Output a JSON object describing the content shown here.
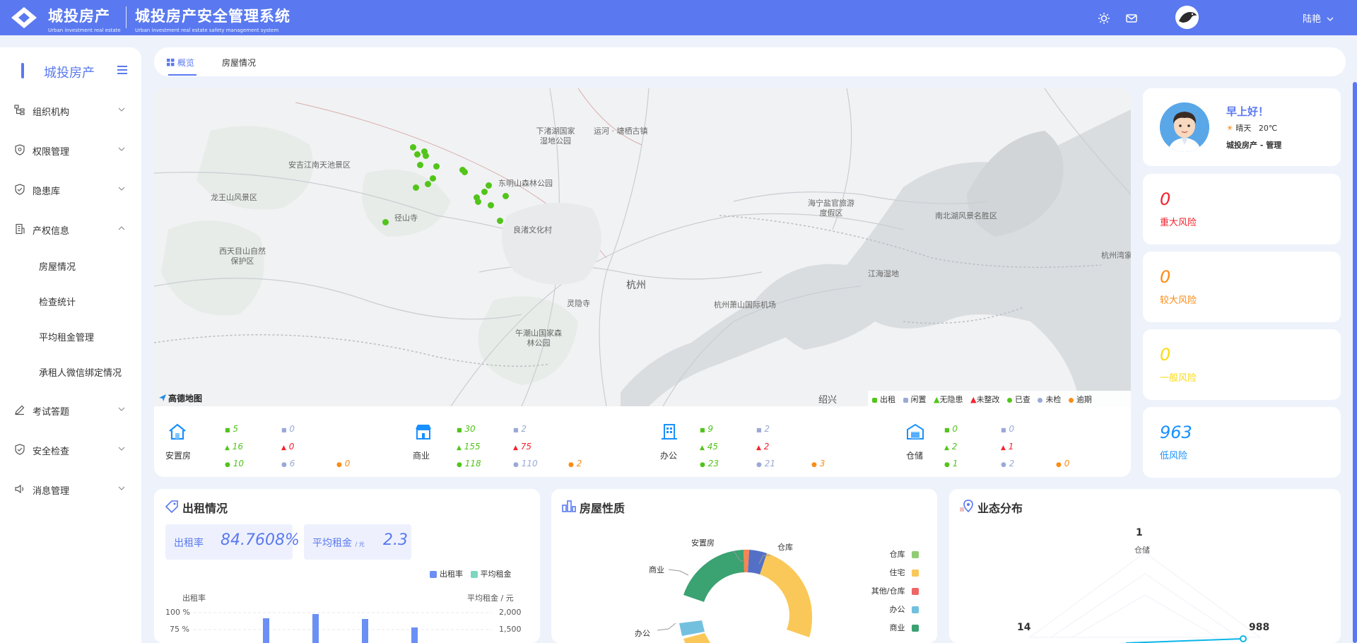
{
  "header": {
    "brand_cn": "城投房产",
    "brand_en": "Urban investment real estate",
    "system_cn": "城投房产安全管理系统",
    "system_en": "Urban investment real estate safety management system",
    "user": "陆艳",
    "icons": [
      "sun-icon",
      "mail-icon",
      "avatar"
    ]
  },
  "sidebar": {
    "title": "城投房产",
    "items": [
      {
        "label": "组织机构",
        "icon": "org-chart-icon"
      },
      {
        "label": "权限管理",
        "icon": "shield-badge-icon"
      },
      {
        "label": "隐患库",
        "icon": "shield-check-icon"
      },
      {
        "label": "产权信息",
        "icon": "building-icon"
      },
      {
        "label": "考试答题",
        "icon": "pencil-icon"
      },
      {
        "label": "安全检查",
        "icon": "shield-check-icon"
      },
      {
        "label": "消息管理",
        "icon": "speaker-icon"
      }
    ],
    "sub_items": [
      "房屋情况",
      "检查统计",
      "平均租金管理",
      "承租人微信绑定情况"
    ]
  },
  "tabs": [
    {
      "label": "概览",
      "active": true
    },
    {
      "label": "房屋情况",
      "active": false
    }
  ],
  "map": {
    "logo": "高德地图",
    "labels": [
      "下渚湖国家湿地公园",
      "运河 · 塘栖古镇",
      "安吉江南天池景区",
      "东明山森林公园",
      "龙王山风景区",
      "径山寺",
      "良渚文化村",
      "海宁盐官旅游度假区",
      "南北湖风景名胜区",
      "西天目山自然保护区",
      "杭州",
      "灵隐寺",
      "杭州萧山国际机场",
      "江海湿地",
      "午潮山国家森林公园",
      "杭州湾家湿地",
      "绍兴"
    ],
    "legend": [
      "出租",
      "闲置",
      "无隐患",
      "未整改",
      "已查",
      "未检",
      "逾期"
    ]
  },
  "stats": [
    {
      "label": "安置房",
      "rent": "5",
      "idle": "0",
      "no_hazard": "16",
      "unfixed": "0",
      "checked": "10",
      "unchecked": "6",
      "overdue": "0"
    },
    {
      "label": "商业",
      "rent": "30",
      "idle": "2",
      "no_hazard": "155",
      "unfixed": "75",
      "checked": "118",
      "unchecked": "110",
      "overdue": "2"
    },
    {
      "label": "办公",
      "rent": "9",
      "idle": "2",
      "no_hazard": "45",
      "unfixed": "2",
      "checked": "23",
      "unchecked": "21",
      "overdue": "3"
    },
    {
      "label": "仓储",
      "rent": "0",
      "idle": "0",
      "no_hazard": "2",
      "unfixed": "1",
      "checked": "1",
      "unchecked": "2",
      "overdue": "0"
    }
  ],
  "greeting": {
    "hello": "早上好！",
    "weather": "晴天",
    "temp": "20℃",
    "org": "城投房产 - 管理"
  },
  "risks": [
    {
      "value": "0",
      "label": "重大风险",
      "color": "#f5222d"
    },
    {
      "value": "0",
      "label": "较大风险",
      "color": "#fa8c16"
    },
    {
      "value": "0",
      "label": "一般风险",
      "color": "#fadb14"
    },
    {
      "value": "963",
      "label": "低风险",
      "color": "#1890ff"
    }
  ],
  "rent_panel": {
    "title": "出租情况",
    "rate_label": "出租率",
    "rate_value": "84.7608%",
    "avg_label": "平均租金",
    "avg_unit": "/ 元",
    "avg_value": "2.3",
    "legend": [
      "出租率",
      "平均租金"
    ],
    "y_left_label": "出租率",
    "y_right_label": "平均租金 / 元",
    "y_left_ticks": [
      "100 %",
      "75 %"
    ],
    "y_right_ticks": [
      "2,000",
      "1,500"
    ]
  },
  "nature_panel": {
    "title": "房屋性质",
    "labels": [
      "安置房",
      "仓库",
      "商业",
      "办公"
    ],
    "legend": [
      {
        "name": "仓库",
        "color": "#91cc75"
      },
      {
        "name": "住宅",
        "color": "#fac858"
      },
      {
        "name": "其他/仓库",
        "color": "#ee6666"
      },
      {
        "name": "办公",
        "color": "#73c0de"
      },
      {
        "name": "商业",
        "color": "#3ba272"
      }
    ]
  },
  "format_panel": {
    "title": "业态分布",
    "items": [
      {
        "value": "1",
        "name": "仓储"
      },
      {
        "value": "14",
        "name": ""
      },
      {
        "value": "988",
        "name": ""
      }
    ]
  },
  "colors": {
    "primary": "#5a79f0",
    "green": "#52c41a",
    "red": "#f5222d",
    "orange": "#fa8c16",
    "grey": "#9aa9d6"
  }
}
